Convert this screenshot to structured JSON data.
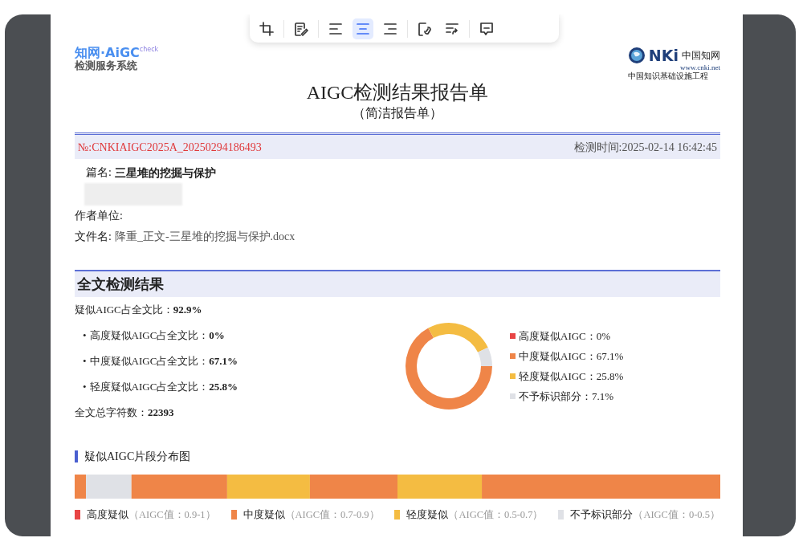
{
  "toolbar": {
    "groups": [
      [
        {
          "kind": "crop",
          "selected": false
        }
      ],
      [
        {
          "kind": "edit",
          "selected": false
        }
      ],
      [
        {
          "kind": "align-left",
          "selected": false
        },
        {
          "kind": "align-center",
          "selected": true
        },
        {
          "kind": "align-right",
          "selected": false
        }
      ],
      [
        {
          "kind": "link",
          "selected": false
        },
        {
          "kind": "wrap",
          "selected": false
        }
      ],
      [
        {
          "kind": "comment",
          "selected": false
        }
      ]
    ]
  },
  "logo_left": {
    "name": "知网·AiGC",
    "tag": "check",
    "subtitle": "检测服务系统"
  },
  "logo_right": {
    "name": "NKi",
    "chinese": "中国知网",
    "url": "www.cnki.net",
    "slogan": "中国知识基础设施工程"
  },
  "title": "AIGC检测结果报告单",
  "subtitle": "（简洁报告单）",
  "report_no": "№:CNKIAIGC2025A_20250294186493",
  "check_time": "检测时间:2025-02-14 16:42:45",
  "fields": [
    {
      "kind": "title",
      "label": "篇名:",
      "value": "三星堆的挖掘与保护"
    },
    {
      "kind": "redacted"
    },
    {
      "kind": "plain",
      "label": "作者单位:"
    },
    {
      "kind": "plain",
      "label": "文件名:",
      "value": "降重_正文-三星堆的挖掘与保护.docx"
    }
  ],
  "section_title": "全文检测结果",
  "stats": [
    {
      "kind": "main",
      "label": "疑似AIGC占全文比：",
      "value": "92.9%"
    },
    {
      "kind": "sub",
      "bullet": "•",
      "label": "高度疑似AIGC占全文比：",
      "value": "0%"
    },
    {
      "kind": "sub",
      "bullet": "•",
      "label": "中度疑似AIGC占全文比：",
      "value": "67.1%"
    },
    {
      "kind": "sub",
      "bullet": "•",
      "label": "轻度疑似AIGC占全文比：",
      "value": "25.8%"
    },
    {
      "kind": "main",
      "label": "全文总字符数：",
      "value": "22393"
    }
  ],
  "donut": {
    "chart_data": {
      "type": "donut",
      "categories": [
        "高度疑似AIGC",
        "中度疑似AIGC",
        "轻度疑似AIGC",
        "不予标识部分"
      ],
      "values": [
        0,
        67.1,
        25.8,
        7.1
      ]
    },
    "legend": [
      {
        "value": "：0%",
        "color": "#e84545"
      },
      {
        "value": "：67.1%",
        "color": "#ef8548"
      },
      {
        "value": "：25.8%",
        "color": "#f4bc42"
      },
      {
        "value": "：7.1%",
        "color": "#dfe1e6"
      }
    ]
  },
  "distribution": {
    "title": "疑似AIGC片段分布图",
    "legend": [
      {
        "kind": "high",
        "label": "高度疑似",
        "range": "（AIGC值：0.9-1）",
        "color": "#e84545"
      },
      {
        "kind": "medium",
        "label": "中度疑似",
        "range": "（AIGC值：0.7-0.9）",
        "color": "#ef8548"
      },
      {
        "kind": "light",
        "label": "轻度疑似",
        "range": "（AIGC值：0.5-0.7）",
        "color": "#f4bc42"
      },
      {
        "kind": "unmarked",
        "label": "不予标识部分",
        "range": "（AIGC值：0-0.5）",
        "color": "#dfe1e6"
      }
    ]
  }
}
